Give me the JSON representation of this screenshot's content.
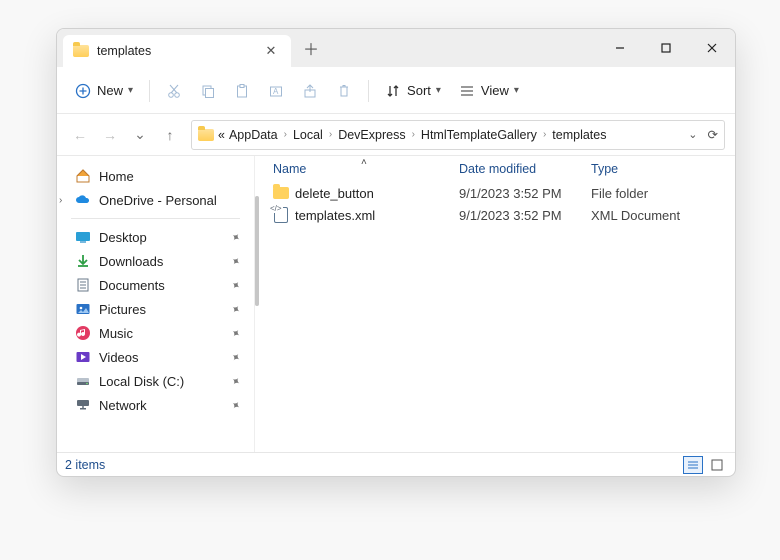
{
  "titlebar": {
    "tab_title": "templates"
  },
  "toolbar": {
    "new_label": "New",
    "sort_label": "Sort",
    "view_label": "View"
  },
  "breadcrumb": {
    "pre": "«",
    "items": [
      "AppData",
      "Local",
      "DevExpress",
      "HtmlTemplateGallery",
      "templates"
    ]
  },
  "sidebar": {
    "home": "Home",
    "onedrive": "OneDrive - Personal",
    "quick": [
      {
        "label": "Desktop",
        "icon": "desktop"
      },
      {
        "label": "Downloads",
        "icon": "download"
      },
      {
        "label": "Documents",
        "icon": "document"
      },
      {
        "label": "Pictures",
        "icon": "pictures"
      },
      {
        "label": "Music",
        "icon": "music"
      },
      {
        "label": "Videos",
        "icon": "videos"
      },
      {
        "label": "Local Disk (C:)",
        "icon": "disk"
      },
      {
        "label": "Network",
        "icon": "network"
      }
    ]
  },
  "columns": {
    "name": "Name",
    "date": "Date modified",
    "type": "Type"
  },
  "items": [
    {
      "name": "delete_button",
      "date": "9/1/2023 3:52 PM",
      "type": "File folder",
      "kind": "folder"
    },
    {
      "name": "templates.xml",
      "date": "9/1/2023 3:52 PM",
      "type": "XML Document",
      "kind": "xml"
    }
  ],
  "status": {
    "count": "2 items"
  }
}
